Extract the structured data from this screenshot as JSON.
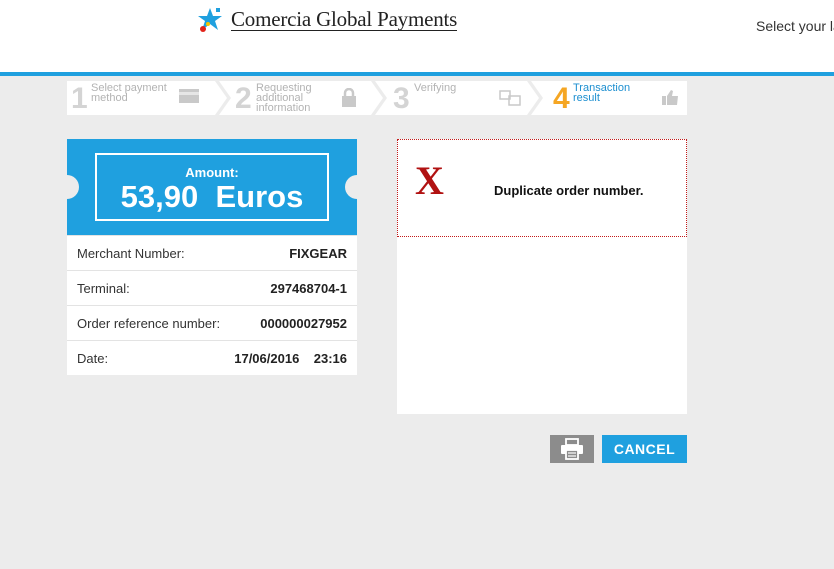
{
  "header": {
    "logo_text": "Comercia Global Payments",
    "logo_icon": "star-logo-icon",
    "language_prompt": "Select your la"
  },
  "steps": [
    {
      "number": "1",
      "label_line1": "Select payment",
      "label_line2": "method",
      "label_line3": "",
      "icon": "card-icon",
      "active": false
    },
    {
      "number": "2",
      "label_line1": "Requesting",
      "label_line2": "additional",
      "label_line3": "information",
      "icon": "lock-icon",
      "active": false
    },
    {
      "number": "3",
      "label_line1": "Verifying",
      "label_line2": "",
      "label_line3": "",
      "icon": "verify-icon",
      "active": false
    },
    {
      "number": "4",
      "label_line1": "Transaction",
      "label_line2": "result",
      "label_line3": "",
      "icon": "thumbs-up-icon",
      "active": true
    }
  ],
  "ticket": {
    "amount_label": "Amount:",
    "amount_value": "53,90  Euros",
    "rows": [
      {
        "label": "Merchant Number:",
        "value": "FIXGEAR"
      },
      {
        "label": "Terminal:",
        "value": "297468704-1"
      },
      {
        "label": "Order reference number:",
        "value": "000000027952"
      },
      {
        "label": "Date:",
        "value": "17/06/2016    23:16"
      }
    ]
  },
  "result": {
    "error_icon": "error-x-icon",
    "error_symbol": "X",
    "message": "Duplicate order number."
  },
  "buttons": {
    "print_icon": "printer-icon",
    "cancel_label": "CANCEL"
  },
  "colors": {
    "accent": "#1fa0df",
    "active_step_number": "#f5a623",
    "error": "#b11212",
    "print_button": "#8c8c8c"
  }
}
